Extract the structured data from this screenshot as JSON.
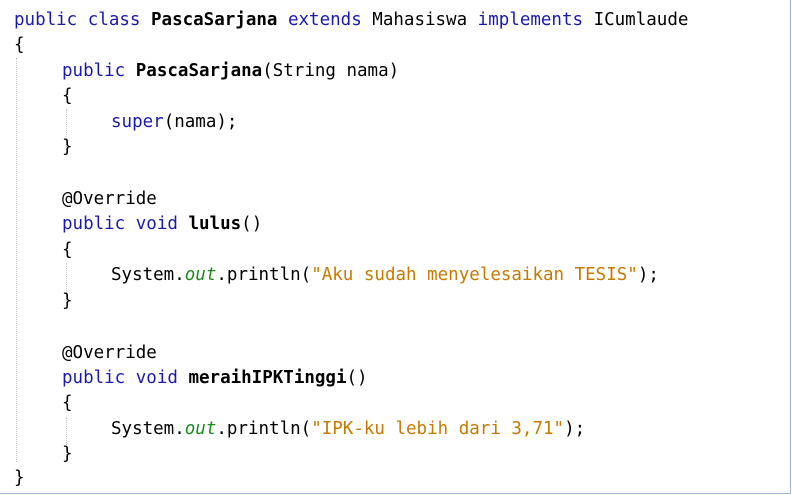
{
  "code": {
    "line1": {
      "kw_public": "public",
      "kw_class": "class",
      "class_name": "PascaSarjana",
      "kw_extends": "extends",
      "super_class": "Mahasiswa",
      "kw_implements": "implements",
      "interface_name": "ICumlaude"
    },
    "open_class_brace": "{",
    "ctor": {
      "kw_public": "public",
      "name": "PascaSarjana",
      "params": "(String nama)",
      "open_brace": "{",
      "kw_super": "super",
      "call_args": "(nama);",
      "close_brace": "}"
    },
    "m1": {
      "annotation": "@Override",
      "kw_public": "public",
      "kw_void": "void",
      "name": "lulus",
      "parens": "()",
      "open_brace": "{",
      "system": "System.",
      "out": "out",
      "println": ".println(",
      "string": "\"Aku sudah menyelesaikan TESIS\"",
      "end": ");",
      "close_brace": "}"
    },
    "m2": {
      "annotation": "@Override",
      "kw_public": "public",
      "kw_void": "void",
      "name": "meraihIPKTinggi",
      "parens": "()",
      "open_brace": "{",
      "system": "System.",
      "out": "out",
      "println": ".println(",
      "string": "\"IPK-ku lebih dari 3,71\"",
      "end": ");",
      "close_brace": "}"
    },
    "close_class_brace": "}"
  },
  "colors": {
    "keyword": "#1a1ab0",
    "string": "#c87a00",
    "static_field": "#1e8a1e",
    "text": "#000000"
  }
}
